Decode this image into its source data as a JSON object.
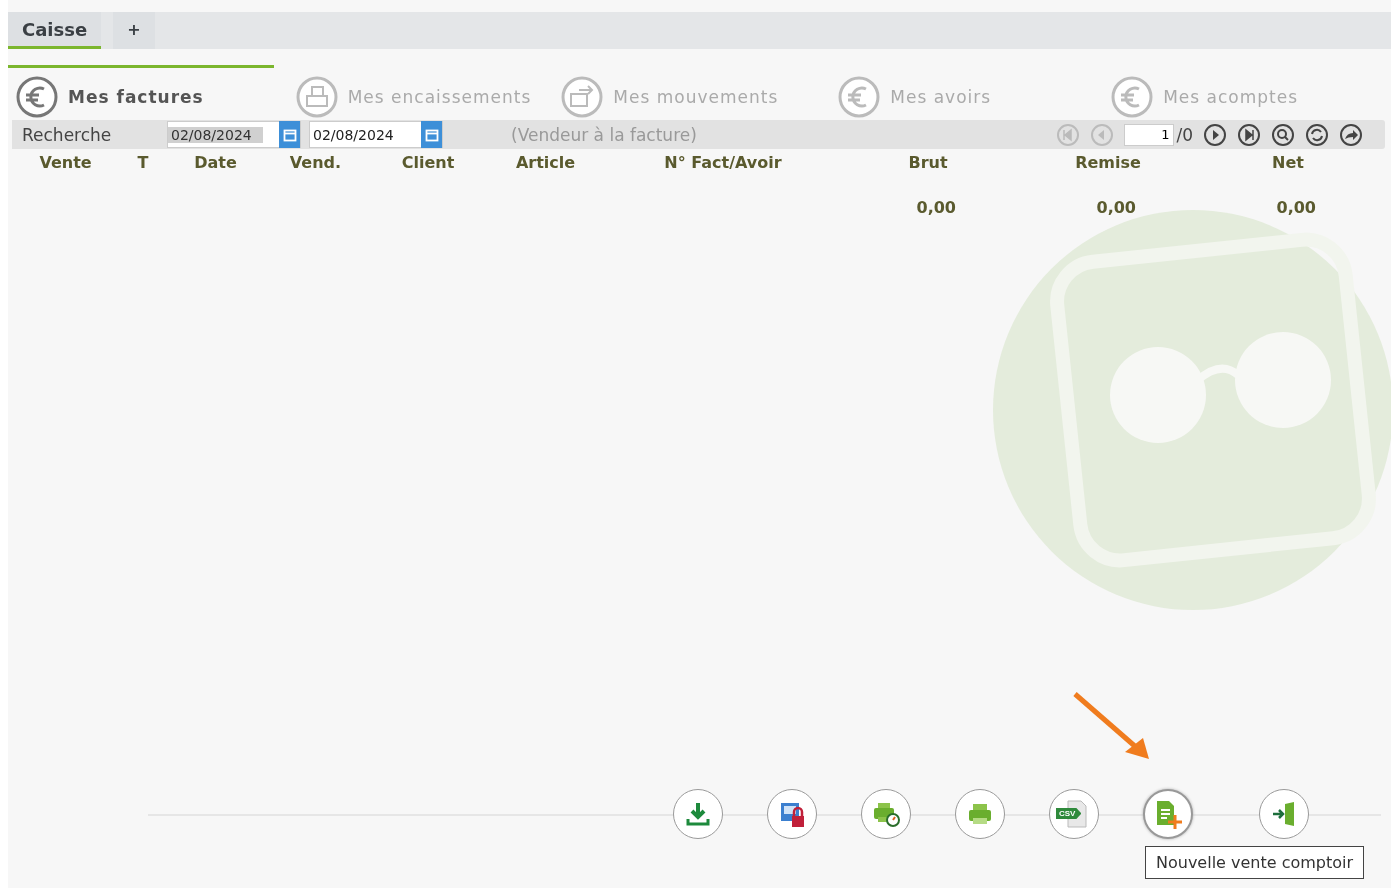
{
  "tabs": [
    {
      "label": "Caisse",
      "selected": true
    },
    {
      "label": "+",
      "selected": false
    }
  ],
  "sections": [
    {
      "label": "Mes factures",
      "kind": "euro",
      "selected": true
    },
    {
      "label": "Mes encaissements",
      "kind": "register",
      "selected": false
    },
    {
      "label": "Mes mouvements",
      "kind": "transfer",
      "selected": false
    },
    {
      "label": "Mes avoirs",
      "kind": "euro",
      "selected": false
    },
    {
      "label": "Mes acomptes",
      "kind": "euro",
      "selected": false
    }
  ],
  "search": {
    "label": "Recherche",
    "date_from": "02/08/2024",
    "date_to": "02/08/2024",
    "seller_note": "(Vendeur à la facture)"
  },
  "pager": {
    "page": "1",
    "total": "/0"
  },
  "columns": [
    "Vente",
    "T",
    "Date",
    "Vend.",
    "Client",
    "Article",
    "N° Fact/Avoir",
    "Brut",
    "Remise",
    "Net"
  ],
  "totals": {
    "brut": "0,00",
    "remise": "0,00",
    "net": "0,00"
  },
  "actions": [
    {
      "kind": "download"
    },
    {
      "kind": "lock"
    },
    {
      "kind": "timer-print"
    },
    {
      "kind": "print"
    },
    {
      "kind": "csv",
      "label": "CSV"
    },
    {
      "kind": "new-sale",
      "highlighted": true
    },
    {
      "kind": "exit"
    }
  ],
  "tooltip": "Nouvelle vente comptoir"
}
